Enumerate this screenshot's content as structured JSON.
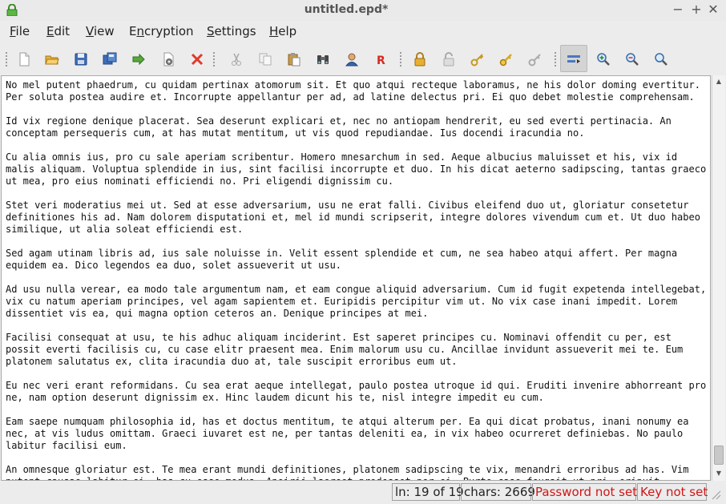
{
  "window": {
    "title": "untitled.epd*",
    "minimize_glyph": "−",
    "maximize_glyph": "+",
    "close_glyph": "✕"
  },
  "menu": {
    "file": {
      "first": "F",
      "rest": "ile"
    },
    "edit": {
      "first": "E",
      "rest": "dit"
    },
    "view": {
      "first": "V",
      "rest": "iew"
    },
    "encryption": {
      "before": "E",
      "under": "n",
      "after": "cryption"
    },
    "settings": {
      "first": "S",
      "rest": "ettings"
    },
    "help": {
      "first": "H",
      "rest": "elp"
    }
  },
  "toolbar_icons": [
    "new-document-icon",
    "open-folder-icon",
    "save-icon",
    "save-as-icon",
    "export-icon",
    "preferences-icon",
    "close-document-icon",
    "cut-icon",
    "copy-icon",
    "paste-icon",
    "binoculars-icon",
    "user-icon",
    "read-only-icon",
    "lock-icon",
    "unlock-icon",
    "key-icon",
    "gold-key-icon",
    "key-remove-icon",
    "toggle-toolbar-icon",
    "zoom-in-icon",
    "zoom-out-icon",
    "zoom-reset-icon"
  ],
  "editor": {
    "paragraphs": [
      "No mel putent phaedrum, cu quidam pertinax atomorum sit. Et quo atqui recteque laboramus, ne his dolor doming evertitur.\nPer soluta postea audire et. Incorrupte appellantur per ad, ad latine delectus pri. Ei quo debet molestie comprehensam.",
      "Id vix regione denique placerat. Sea deserunt explicari et, nec no antiopam hendrerit, eu sed everti pertinacia. An\nconceptam persequeris cum, at has mutat mentitum, ut vis quod repudiandae. Ius docendi iracundia no.",
      "Cu alia omnis ius, pro cu sale aperiam scribentur. Homero mnesarchum in sed. Aeque albucius maluisset et his, vix id\nmalis aliquam. Voluptua splendide in ius, sint facilisi incorrupte et duo. In his dicat aeterno sadipscing, tantas graeco\nut mea, pro eius nominati efficiendi no. Pri eligendi dignissim cu.",
      "Stet veri moderatius mei ut. Sed at esse adversarium, usu ne erat falli. Civibus eleifend duo ut, gloriatur consetetur\ndefinitiones his ad. Nam dolorem disputationi et, mel id mundi scripserit, integre dolores vivendum cum et. Ut duo habeo\nsimilique, ut alia soleat efficiendi est.",
      "Sed agam utinam libris ad, ius sale noluisse in. Velit essent splendide et cum, ne sea habeo atqui affert. Per magna\nequidem ea. Dico legendos ea duo, solet assueverit ut usu.",
      "Ad usu nulla verear, ea modo tale argumentum nam, et eam congue aliquid adversarium. Cum id fugit expetenda intellegebat,\nvix cu natum aperiam principes, vel agam sapientem et. Euripidis percipitur vim ut. No vix case inani impedit. Lorem\ndissentiet vis ea, qui magna option ceteros an. Denique principes at mei.",
      "Facilisi consequat at usu, te his adhuc aliquam inciderint. Est saperet principes cu. Nominavi offendit cu per, est\npossit everti facilisis cu, cu case elitr praesent mea. Enim malorum usu cu. Ancillae invidunt assueverit mei te. Eum\nplatonem salutatus ex, clita iracundia duo at, tale suscipit erroribus eum ut.",
      "Eu nec veri erant reformidans. Cu sea erat aeque intellegat, paulo postea utroque id qui. Eruditi invenire abhorreant pro\nne, nam option deserunt dignissim ex. Hinc laudem dicunt his te, nisl integre impedit eu cum.",
      "Eam saepe numquam philosophia id, has et doctus mentitum, te atqui alterum per. Ea qui dicat probatus, inani nonumy ea\nnec, at vis ludus omittam. Graeci iuvaret est ne, per tantas deleniti ea, in vix habeo ocurreret definiebas. No paulo\nlabitur facilisi eum.",
      "An omnesque gloriatur est. Te mea erant mundi definitiones, platonem sadipscing te vix, menandri erroribus ad has. Vim\nputent causae labitur ei, has cu esse modus. Apeirii laoreet prodesset per ei. Purto case feugait ut pri, eripuit"
    ]
  },
  "status": {
    "line": "ln: 19 of 19",
    "chars": "chars: 2669",
    "password": "Password not set",
    "key": "Key not set"
  },
  "colors": {
    "warning": "#d01616",
    "title": "#555555"
  }
}
